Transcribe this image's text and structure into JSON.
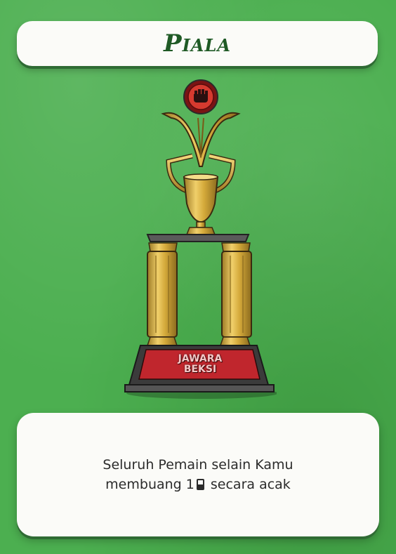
{
  "card": {
    "title": "Piala",
    "trophy_plaque": [
      "JAWARA",
      "BEKSI"
    ],
    "effect_line1": "Seluruh Pemain selain Kamu",
    "effect_line2_prefix": "membuang 1",
    "effect_line2_suffix": " secara acak",
    "effect_icon": "card-icon"
  },
  "colors": {
    "background": "#4caf50",
    "title": "#1f5a25",
    "gold": "#d4a93a",
    "plaque_red": "#c0262d"
  }
}
